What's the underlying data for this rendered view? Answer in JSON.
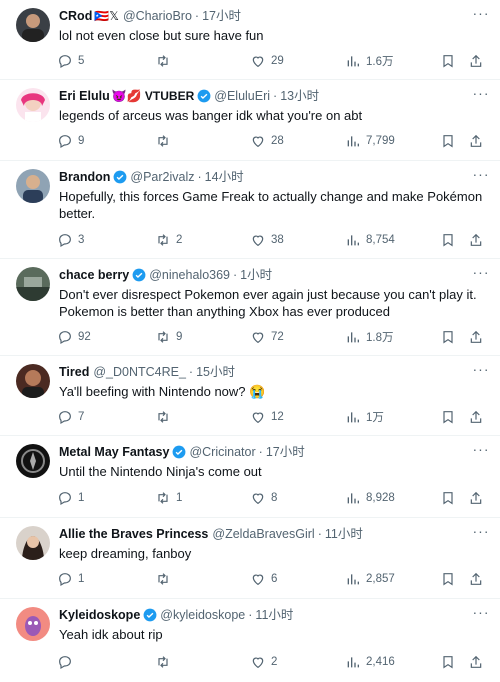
{
  "tweets": [
    {
      "name": "CRod",
      "emoji": "🇵🇷𝕏",
      "handle": "@CharioBro",
      "time": "17小时",
      "text": "lol not even close but sure have fun",
      "replies": "5",
      "retweets": "",
      "likes": "29",
      "views": "1.6万",
      "verified": false
    },
    {
      "name": "Eri Elulu",
      "emoji": "😈💋 VTUBER",
      "handle": "@EluluEri",
      "time": "13小时",
      "text": "legends of arceus was banger idk what you're on abt",
      "replies": "9",
      "retweets": "",
      "likes": "28",
      "views": "7,799",
      "verified": true
    },
    {
      "name": "Brandon",
      "emoji": "",
      "handle": "@Par2ivalz",
      "time": "14小时",
      "text": "Hopefully, this forces Game Freak to actually change and make Pokémon better.",
      "replies": "3",
      "retweets": "2",
      "likes": "38",
      "views": "8,754",
      "verified": true
    },
    {
      "name": "chace berry",
      "emoji": "",
      "handle": "@ninehalo369",
      "time": "1小时",
      "text": "Don't ever disrespect Pokemon ever again just because you can't play it. Pokemon is better than anything Xbox has ever produced",
      "replies": "92",
      "retweets": "9",
      "likes": "72",
      "views": "1.8万",
      "verified": true
    },
    {
      "name": "Tired",
      "emoji": "",
      "handle": "@_D0NTC4RE_",
      "time": "15小时",
      "text": "Ya'll beefing with Nintendo now? 😭",
      "replies": "7",
      "retweets": "",
      "likes": "12",
      "views": "1万",
      "verified": false
    },
    {
      "name": "Metal May Fantasy",
      "emoji": "",
      "handle": "@Cricinator",
      "time": "17小时",
      "text": "Until the Nintendo Ninja's come out",
      "replies": "1",
      "retweets": "1",
      "likes": "8",
      "views": "8,928",
      "verified": true
    },
    {
      "name": "Allie the Braves Princess",
      "emoji": "",
      "handle": "@ZeldaBravesGirl",
      "time": "11小时",
      "text": "keep dreaming, fanboy",
      "replies": "1",
      "retweets": "",
      "likes": "6",
      "views": "2,857",
      "verified": false
    },
    {
      "name": "Kyleidoskope",
      "emoji": "",
      "handle": "@kyleidoskope",
      "time": "11小时",
      "text": "Yeah idk about rip",
      "replies": "",
      "retweets": "",
      "likes": "2",
      "views": "2,416",
      "verified": true
    }
  ],
  "colors": {
    "verified": "#1d9bf0",
    "muted": "#536471",
    "divider": "#eff3f4"
  }
}
